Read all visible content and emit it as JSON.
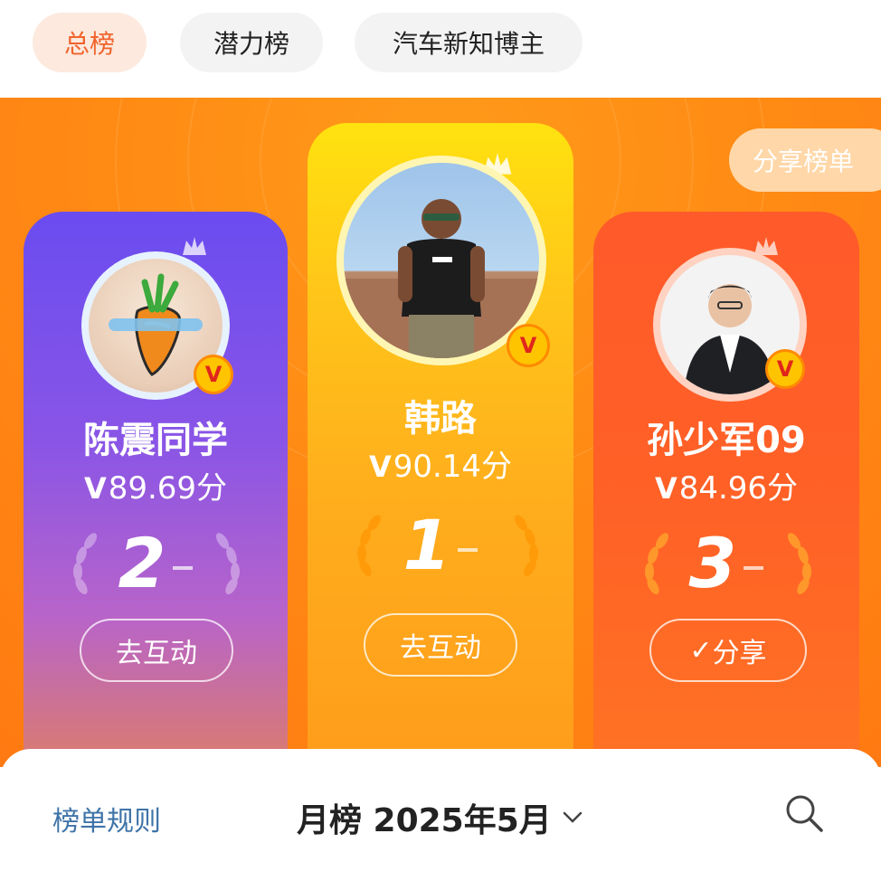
{
  "tabs": [
    {
      "label": "总榜",
      "active": true
    },
    {
      "label": "潜力榜",
      "active": false
    },
    {
      "label": "汽车新知博主",
      "active": false
    }
  ],
  "share_list_label": "分享榜单",
  "cards": {
    "first": {
      "name": "韩路",
      "score_mark": "V",
      "score": "90.14分",
      "rank": "1",
      "action": "去互动"
    },
    "second": {
      "name": "陈震同学",
      "score_mark": "V",
      "score": "89.69分",
      "rank": "2",
      "action": "去互动"
    },
    "third": {
      "name": "孙少军09",
      "score_mark": "V",
      "score": "84.96分",
      "rank": "3",
      "action_check": "✓",
      "action": "分享"
    }
  },
  "bottom": {
    "rules": "榜单规则",
    "period": "月榜 2025年5月"
  },
  "colors": {
    "accent": "#f0632b",
    "hero": "#ff8a14",
    "card1": "#ffc619",
    "card2": "#7a52ec",
    "card3": "#ff5a2a",
    "rules_link": "#3f74a8"
  }
}
